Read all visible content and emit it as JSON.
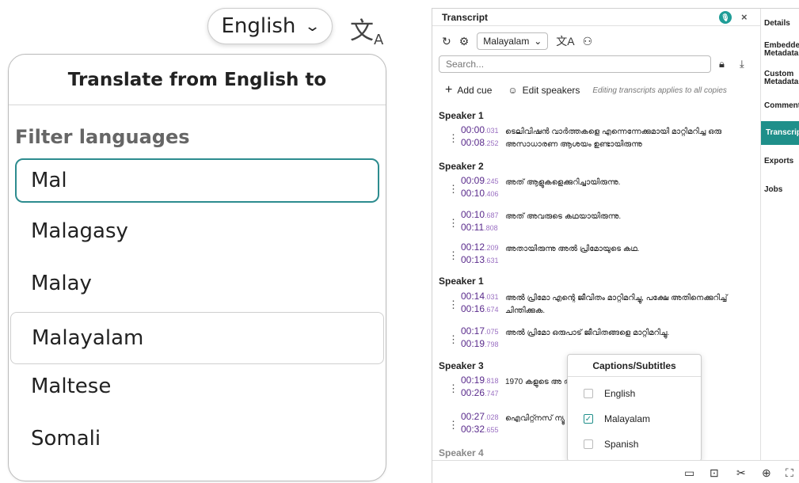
{
  "zoom": {
    "language_button": "English",
    "popover_title": "Translate from English to",
    "filter_label": "Filter languages",
    "filter_value": "Mal",
    "options": [
      "Malagasy",
      "Malay",
      "Malayalam",
      "Maltese",
      "Somali"
    ],
    "selected_option": "Malayalam"
  },
  "app": {
    "panel_title": "Transcript",
    "language_select": "Malayalam",
    "search_placeholder": "Search...",
    "add_cue": "Add cue",
    "edit_speakers": "Edit speakers",
    "edit_note": "Editing transcripts applies to all copies",
    "speakers": [
      "Speaker 1",
      "Speaker 2",
      "Speaker 1",
      "Speaker 3",
      "Speaker 4"
    ],
    "cues": [
      {
        "start": "00:00",
        "start_ms": ".031",
        "end": "00:08",
        "end_ms": ".252",
        "text": "ടെലിവിഷൻ വാർത്തകളെ എന്നെന്നേക്കുമായി മാറ്റിമറിച്ച ഒരു അസാധാരണ ആശയം ഉണ്ടായിരുന്നു"
      },
      {
        "start": "00:09",
        "start_ms": ".245",
        "end": "00:10",
        "end_ms": ".406",
        "text": "അത് ആളുകളെക്കുറിച്ചായിരുന്നു."
      },
      {
        "start": "00:10",
        "start_ms": ".687",
        "end": "00:11",
        "end_ms": ".808",
        "text": "അത് അവരുടെ കഥയായിരുന്നു."
      },
      {
        "start": "00:12",
        "start_ms": ".209",
        "end": "00:13",
        "end_ms": ".631",
        "text": "അതായിരുന്നു അൽ പ്രിമോയുടെ കഥ."
      },
      {
        "start": "00:14",
        "start_ms": ".031",
        "end": "00:16",
        "end_ms": ".674",
        "text": "അൽ പ്രിമോ എന്റെ ജീവിതം മാറ്റിമറിച്ചു, പക്ഷേ അതിനെക്കുറിച്ച് ചിന്തിക്കുക."
      },
      {
        "start": "00:17",
        "start_ms": ".075",
        "end": "00:19",
        "end_ms": ".798",
        "text": "അൽ പ്രിമോ ഒരുപാട് ജീവിതങ്ങളെ മാറ്റിമറിച്ചു."
      },
      {
        "start": "00:19",
        "start_ms": ".818",
        "end": "00:26",
        "end_ms": ".747",
        "text": "1970 കളുടെ അ                                  താഴേക്ക് പോകുകയാണെ"
      },
      {
        "start": "00:27",
        "start_ms": ".028",
        "end": "00:32",
        "end_ms": ".655",
        "text": "ഐവിറ്റ്നസ് ന്യൂ                                  രുന്ന മാതൃകയായിരു"
      }
    ],
    "nav": [
      "Details",
      "Embedded Metadata",
      "Custom Metadata",
      "Comments",
      "Transcript",
      "Exports",
      "Jobs"
    ],
    "captions_menu": {
      "title": "Captions/Subtitles",
      "items": [
        {
          "label": "English",
          "checked": false
        },
        {
          "label": "Malayalam",
          "checked": true
        },
        {
          "label": "Spanish",
          "checked": false
        }
      ]
    }
  }
}
